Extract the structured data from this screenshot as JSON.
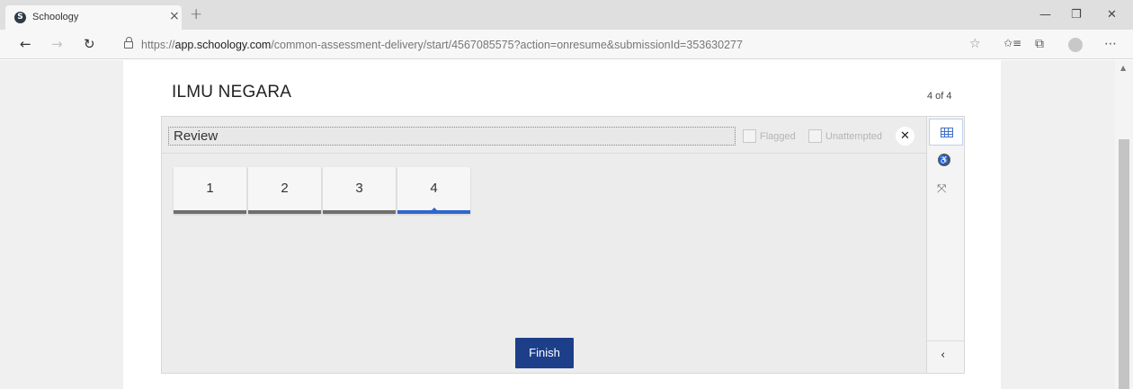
{
  "browser": {
    "tab_title": "Schoology",
    "tab_favicon": "S",
    "tab_close": "×",
    "new_tab": "+",
    "url_prefix": "https://",
    "url_host": "app.schoology.com",
    "url_path": "/common-assessment-delivery/start/4567085575?action=onresume&submissionId=353630277",
    "icons": {
      "back": "←",
      "forward": "→",
      "refresh": "↻",
      "favorite": "☆",
      "favorites_bar": "✩≡",
      "collections": "⧉",
      "more": "⋯",
      "minimize": "—",
      "maximize": "❐",
      "close": "✕"
    }
  },
  "assessment": {
    "title": "ILMU NEGARA",
    "page_count": "4 of 4",
    "review_label": "Review",
    "filters": {
      "flagged": "Flagged",
      "unattempted": "Unattempted"
    },
    "close_icon": "✕",
    "questions": [
      "1",
      "2",
      "3",
      "4"
    ],
    "active_question": "4",
    "finish_label": "Finish"
  },
  "rail": {
    "grid_icon": "grid-icon",
    "accessibility_icon": "accessibility-icon",
    "expand_icon": "expand-icon",
    "collapse_glyph": "‹",
    "accessibility_glyph": "♿",
    "expand_glyph": "⤧"
  },
  "colors": {
    "accent": "#2f66cf",
    "finish_button": "#1d3f8a",
    "panel_bg": "#ececec"
  }
}
